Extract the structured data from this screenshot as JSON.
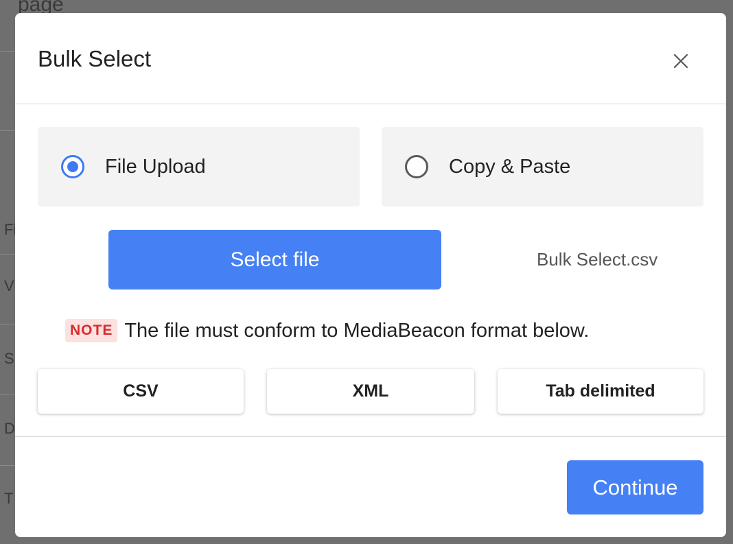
{
  "background": {
    "page_text": "page",
    "row_letters": [
      "Fi",
      "V",
      "S",
      "D",
      "T"
    ]
  },
  "dialog": {
    "title": "Bulk Select",
    "close_icon": "close-icon"
  },
  "upload_options": [
    {
      "label": "File Upload",
      "selected": true
    },
    {
      "label": "Copy & Paste",
      "selected": false
    }
  ],
  "file": {
    "select_button_label": "Select file",
    "selected_file_name": "Bulk Select.csv"
  },
  "note": {
    "badge": "NOTE",
    "text": "The file must conform to MediaBeacon format below."
  },
  "formats": [
    "CSV",
    "XML",
    "Tab delimited"
  ],
  "footer": {
    "continue_label": "Continue"
  },
  "colors": {
    "accent": "#4580f5",
    "note_badge_bg": "#fde0e0",
    "note_badge_text": "#d62d2d"
  }
}
